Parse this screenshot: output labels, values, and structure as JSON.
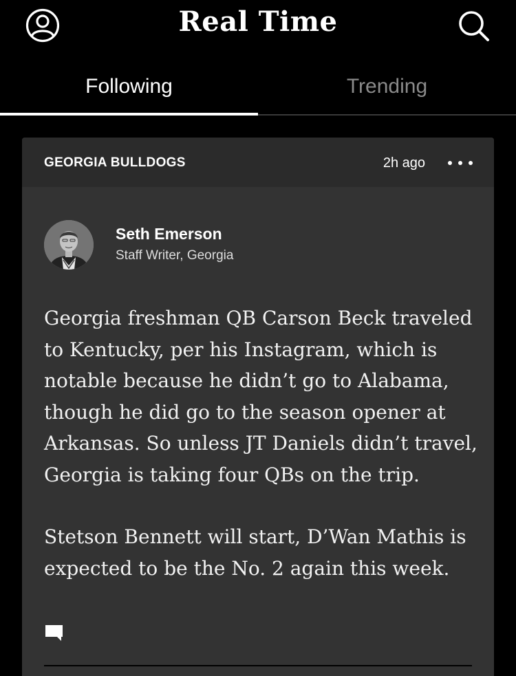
{
  "header": {
    "title": "Real Time",
    "profile_icon": "user-circle-icon",
    "search_icon": "search-icon"
  },
  "tabs": [
    {
      "label": "Following",
      "active": true
    },
    {
      "label": "Trending",
      "active": false
    }
  ],
  "post": {
    "team": "GEORGIA BULLDOGS",
    "time_ago": "2h ago",
    "more_icon": "more-dots-icon",
    "author": {
      "name": "Seth Emerson",
      "role": "Staff Writer, Georgia"
    },
    "paragraphs": [
      "Georgia freshman QB Carson Beck traveled to Kentucky, per his Instagram, which is notable because he didn’t go to Alabama, though he did go to the season opener at Arkansas. So unless JT Daniels didn’t travel, Georgia is taking four QBs on the trip.",
      "Stetson Bennett will start, D’Wan Mathis is expected to be the No. 2 again this week."
    ],
    "comment_icon": "comment-icon"
  },
  "colors": {
    "background": "#000000",
    "card": "#333333",
    "card_header": "#2b2b2b",
    "inactive_tab": "#8a8a8a"
  }
}
